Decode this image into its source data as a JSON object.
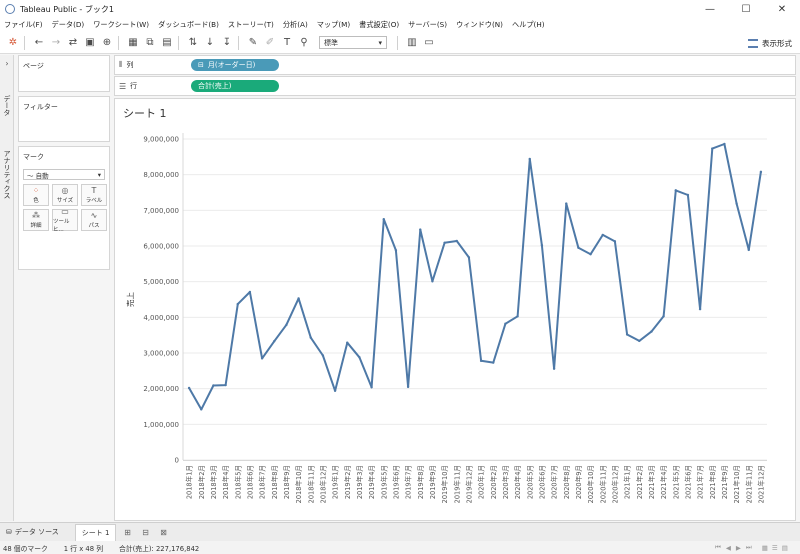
{
  "window": {
    "title": "Tableau Public - ブック1",
    "controls": [
      "—",
      "☐",
      "✕"
    ]
  },
  "menu": [
    "ファイル(F)",
    "データ(D)",
    "ワークシート(W)",
    "ダッシュボード(B)",
    "ストーリー(T)",
    "分析(A)",
    "マップ(M)",
    "書式設定(O)",
    "サーバー(S)",
    "ウィンドウ(N)",
    "ヘルプ(H)"
  ],
  "toolbar": {
    "mark_size_value": "標準",
    "show_me_label": "表示形式"
  },
  "left_tabs": [
    "データ",
    "アナリティクス"
  ],
  "panels": {
    "pages": "ページ",
    "filters": "フィルター",
    "marks": "マーク",
    "mark_type": "自動",
    "mark_buttons": [
      "色",
      "サイズ",
      "ラベル",
      "詳細",
      "ツールヒ...",
      "パス"
    ]
  },
  "shelves": {
    "columns_label": "列",
    "rows_label": "行",
    "columns_pill": "月(オーダー日)",
    "rows_pill": "合計(売上)",
    "columns_pill_color": "#4a9ab8",
    "rows_pill_color": "#1aaa7a"
  },
  "sheet_title": "シート 1",
  "chart_data": {
    "type": "line",
    "ylabel": "売上",
    "ylim": [
      0,
      9000000
    ],
    "yticks": [
      "0",
      "1,000,000",
      "2,000,000",
      "3,000,000",
      "4,000,000",
      "5,000,000",
      "6,000,000",
      "7,000,000",
      "8,000,000",
      "9,000,000"
    ],
    "line_color": "#4e79a7",
    "x": [
      "2018年1月",
      "2018年2月",
      "2018年3月",
      "2018年4月",
      "2018年5月",
      "2018年6月",
      "2018年7月",
      "2018年8月",
      "2018年9月",
      "2018年10月",
      "2018年11月",
      "2018年12月",
      "2019年1月",
      "2019年2月",
      "2019年3月",
      "2019年4月",
      "2019年5月",
      "2019年6月",
      "2019年7月",
      "2019年8月",
      "2019年9月",
      "2019年10月",
      "2019年11月",
      "2019年12月",
      "2020年1月",
      "2020年2月",
      "2020年3月",
      "2020年4月",
      "2020年5月",
      "2020年6月",
      "2020年7月",
      "2020年8月",
      "2020年9月",
      "2020年10月",
      "2020年11月",
      "2020年12月",
      "2021年1月",
      "2021年2月",
      "2021年3月",
      "2021年4月",
      "2021年5月",
      "2021年6月",
      "2021年7月",
      "2021年8月",
      "2021年9月",
      "2021年10月",
      "2021年11月",
      "2021年12月"
    ],
    "values": [
      2020000,
      1420000,
      2090000,
      2100000,
      4370000,
      4710000,
      2850000,
      3330000,
      3790000,
      4530000,
      3430000,
      2930000,
      1940000,
      3290000,
      2880000,
      2040000,
      6750000,
      5880000,
      2050000,
      6460000,
      5010000,
      6090000,
      6140000,
      5680000,
      2780000,
      2730000,
      3820000,
      4030000,
      8440000,
      6020000,
      2560000,
      7190000,
      5950000,
      5770000,
      6310000,
      6130000,
      3520000,
      3340000,
      3600000,
      4030000,
      7560000,
      7430000,
      4230000,
      8730000,
      8860000,
      7190000,
      5890000,
      8080000
    ]
  },
  "bottom_tabs": {
    "datasource": "データ ソース",
    "sheet": "シート 1"
  },
  "status": {
    "marks": "48 個のマーク",
    "dims": "1 行 x 48 列",
    "sum": "合計(売上): 227,176,842"
  }
}
